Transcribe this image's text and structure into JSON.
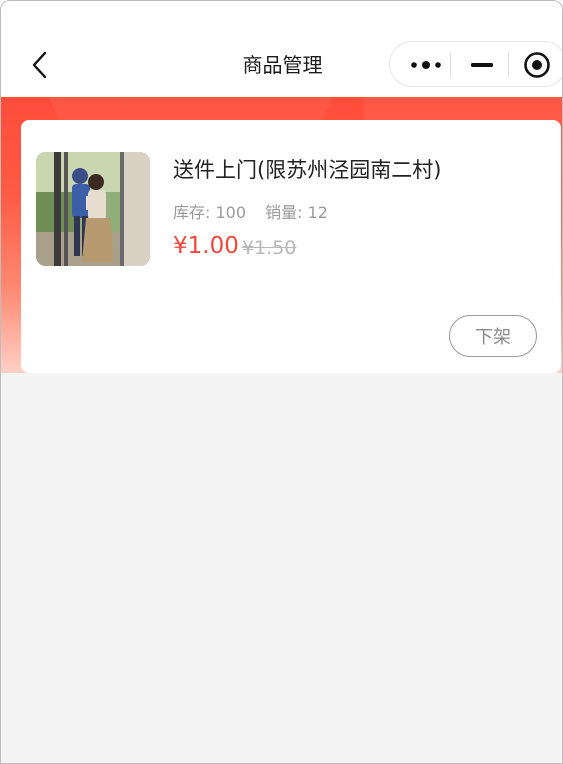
{
  "nav": {
    "title": "商品管理",
    "back_icon": "chevron-left-icon",
    "capsule": {
      "more_icon": "more-dots-icon",
      "minimize_icon": "minimize-icon",
      "close_icon": "target-circle-icon"
    }
  },
  "colors": {
    "accent": "#ff4d3a",
    "price": "#f0483c",
    "muted": "#9a9a9a",
    "background": "#f4f4f4"
  },
  "product": {
    "name": "送件上门(限苏州泾园南二村)",
    "stock_label": "库存: 100",
    "sales_label": "销量: 12",
    "price": "¥1.00",
    "original_price": "¥1.50",
    "action_label": "下架"
  }
}
